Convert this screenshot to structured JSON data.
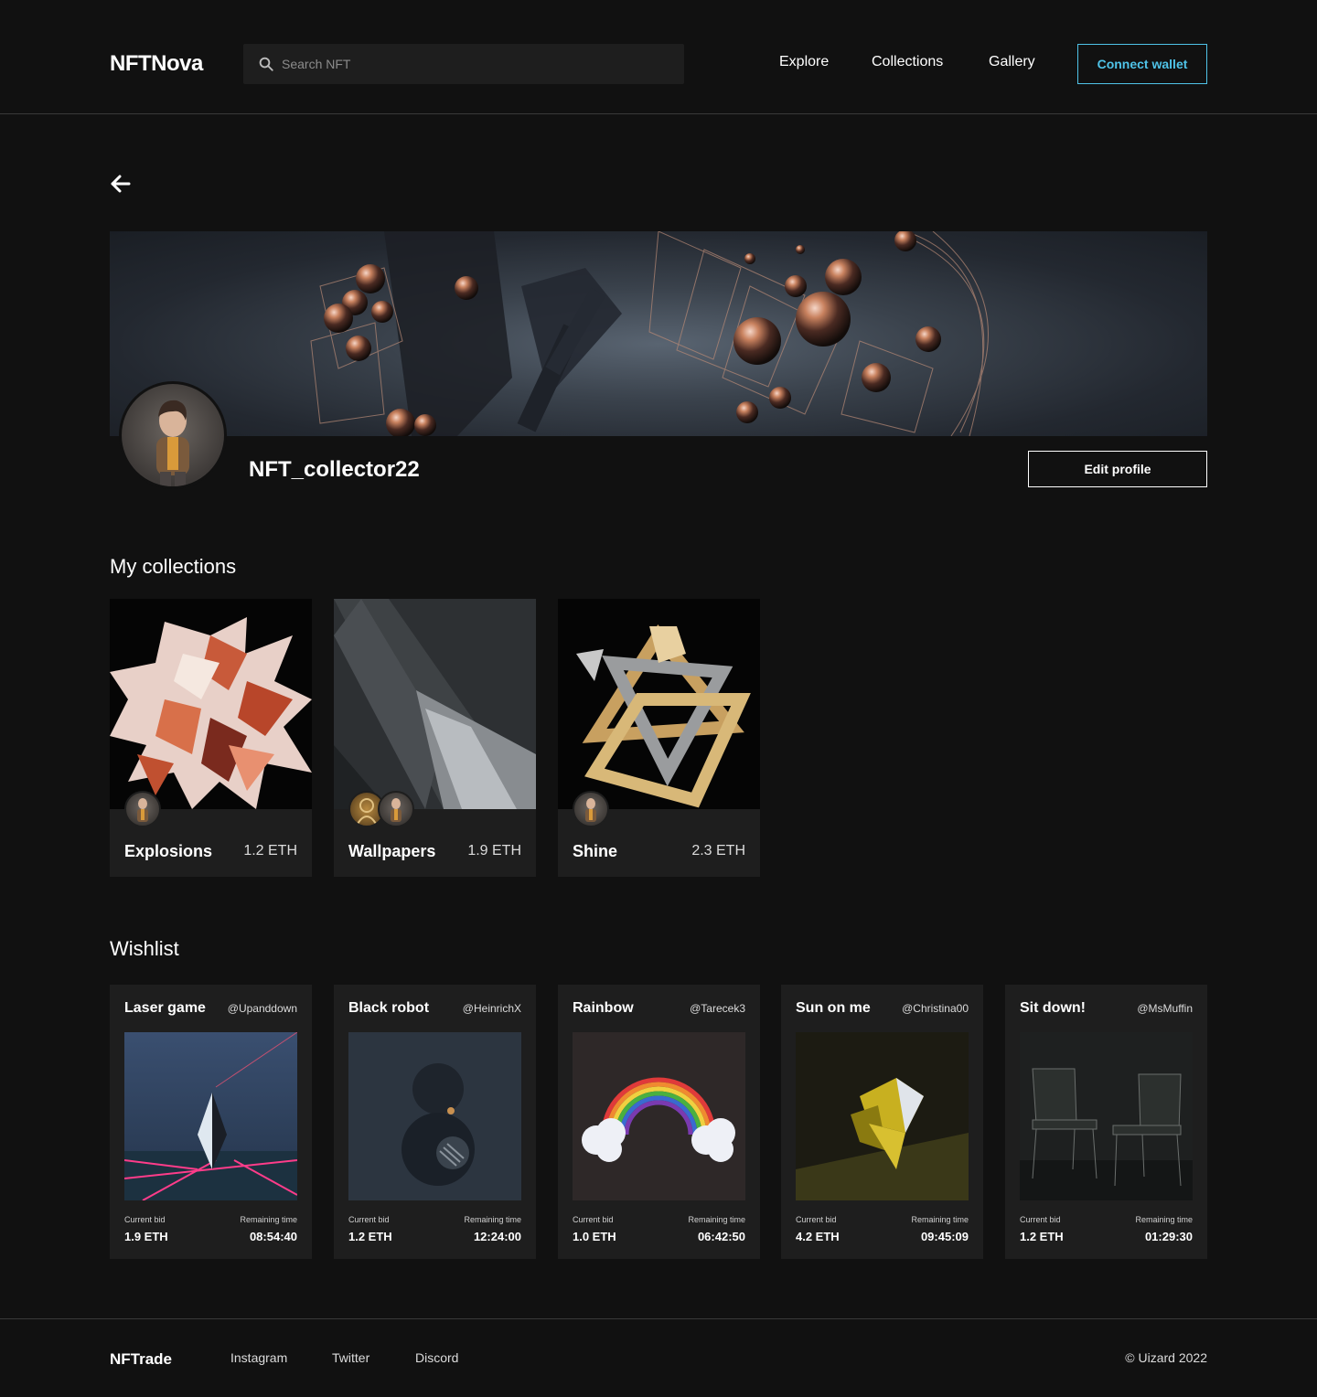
{
  "header": {
    "logo": "NFTNova",
    "search_placeholder": "Search NFT",
    "nav": [
      "Explore",
      "Collections",
      "Gallery"
    ],
    "connect_label": "Connect wallet"
  },
  "profile": {
    "username": "NFT_collector22",
    "edit_label": "Edit profile"
  },
  "collections": {
    "title": "My collections",
    "items": [
      {
        "name": "Explosions",
        "price": "1.2 ETH"
      },
      {
        "name": "Wallpapers",
        "price": "1.9 ETH"
      },
      {
        "name": "Shine",
        "price": "2.3 ETH"
      }
    ]
  },
  "wishlist": {
    "title": "Wishlist",
    "bid_label": "Current bid",
    "time_label": "Remaining time",
    "items": [
      {
        "title": "Laser game",
        "handle": "@Upanddown",
        "bid": "1.9 ETH",
        "time": "08:54:40"
      },
      {
        "title": "Black robot",
        "handle": "@HeinrichX",
        "bid": "1.2 ETH",
        "time": "12:24:00"
      },
      {
        "title": "Rainbow",
        "handle": "@Tarecek3",
        "bid": "1.0 ETH",
        "time": "06:42:50"
      },
      {
        "title": "Sun on me",
        "handle": "@Christina00",
        "bid": "4.2 ETH",
        "time": "09:45:09"
      },
      {
        "title": "Sit down!",
        "handle": "@MsMuffin",
        "bid": "1.2 ETH",
        "time": "01:29:30"
      }
    ]
  },
  "footer": {
    "logo": "NFTrade",
    "links": [
      "Instagram",
      "Twitter",
      "Discord"
    ],
    "copyright": "© Uizard 2022"
  },
  "colors": {
    "background": "#111111",
    "card": "#1e1e1e",
    "accent": "#4fc3e8"
  }
}
